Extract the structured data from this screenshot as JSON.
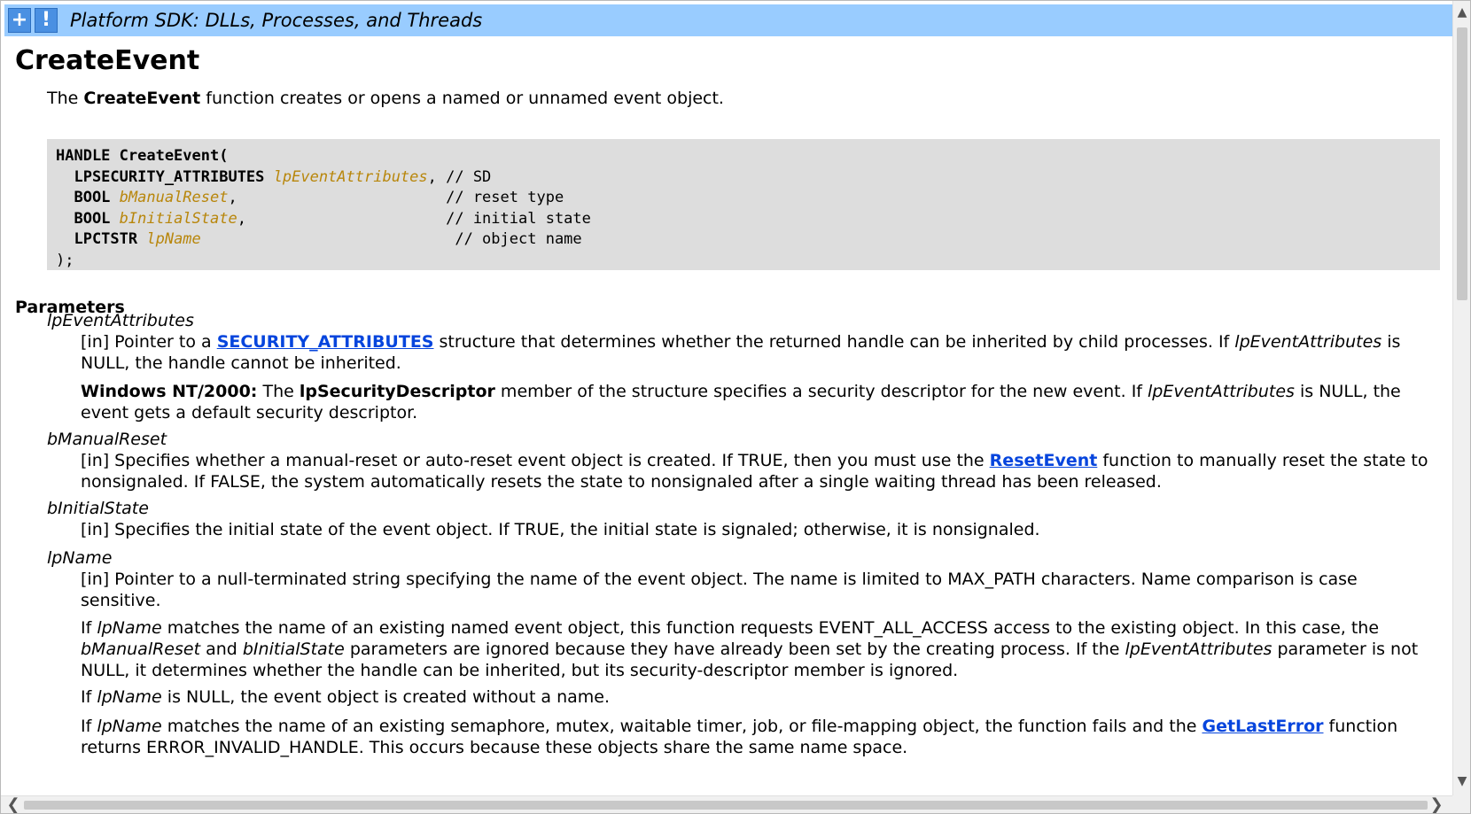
{
  "banner": {
    "expand_icon": "+",
    "alert_icon": "!",
    "title": "Platform SDK: DLLs, Processes, and Threads"
  },
  "page": {
    "title": "CreateEvent",
    "intro_prefix": "The ",
    "intro_bold": "CreateEvent",
    "intro_suffix": " function creates or opens a named or unnamed event object."
  },
  "code": {
    "line1": "HANDLE CreateEvent(",
    "l2_type": "  LPSECURITY_ATTRIBUTES ",
    "l2_param": "lpEventAttributes",
    "l2_rest": ", // SD",
    "l3_type": "  BOOL ",
    "l3_param": "bManualReset",
    "l3_rest": ",                       // reset type",
    "l4_type": "  BOOL ",
    "l4_param": "bInitialState",
    "l4_rest": ",                      // initial state",
    "l5_type": "  LPCTSTR ",
    "l5_param": "lpName",
    "l5_rest": "                            // object name",
    "line6": ");"
  },
  "parameters": {
    "heading": "Parameters",
    "p1": {
      "term": "lpEventAttributes",
      "d1_a": "[in] Pointer to a ",
      "d1_link": "SECURITY_ATTRIBUTES",
      "d1_b": " structure that determines whether the returned handle can be inherited by child processes. If ",
      "d1_i": "lpEventAttributes",
      "d1_c": " is NULL, the handle cannot be inherited.",
      "d2_bold": "Windows NT/2000:",
      "d2_a": " The ",
      "d2_bold2": "lpSecurityDescriptor",
      "d2_b": " member of the structure specifies a security descriptor for the new event. If ",
      "d2_i": "lpEventAttributes",
      "d2_c": " is NULL, the event gets a default security descriptor."
    },
    "p2": {
      "term": "bManualReset",
      "d1_a": "[in] Specifies whether a manual-reset or auto-reset event object is created. If TRUE, then you must use the ",
      "d1_link": "ResetEvent",
      "d1_b": " function to manually reset the state to nonsignaled. If FALSE, the system automatically resets the state to nonsignaled after a single waiting thread has been released."
    },
    "p3": {
      "term": "bInitialState",
      "d1": "[in] Specifies the initial state of the event object. If TRUE, the initial state is signaled; otherwise, it is nonsignaled."
    },
    "p4": {
      "term": "lpName",
      "d1": "[in] Pointer to a null-terminated string specifying the name of the event object. The name is limited to MAX_PATH characters. Name comparison is case sensitive.",
      "d2_a": "If ",
      "d2_i1": "lpName",
      "d2_b": " matches the name of an existing named event object, this function requests EVENT_ALL_ACCESS access to the existing object. In this case, the ",
      "d2_i2": "bManualReset",
      "d2_c": " and ",
      "d2_i3": "bInitialState",
      "d2_d": " parameters are ignored because they have already been set by the creating process. If the ",
      "d2_i4": "lpEventAttributes",
      "d2_e": " parameter is not NULL, it determines whether the handle can be inherited, but its security-descriptor member is ignored.",
      "d3_a": "If ",
      "d3_i": "lpName",
      "d3_b": " is NULL, the event object is created without a name.",
      "d4_a": "If ",
      "d4_i": "lpName",
      "d4_b": " matches the name of an existing semaphore, mutex, waitable timer, job, or file-mapping object, the function fails and the ",
      "d4_link": "GetLastError",
      "d4_c": " function returns ERROR_INVALID_HANDLE. This occurs because these objects share the same name space."
    }
  },
  "scrollbars": {
    "up_arrow": "▲",
    "down_arrow": "▼",
    "left_arrow": "❮",
    "right_arrow": "❯"
  }
}
